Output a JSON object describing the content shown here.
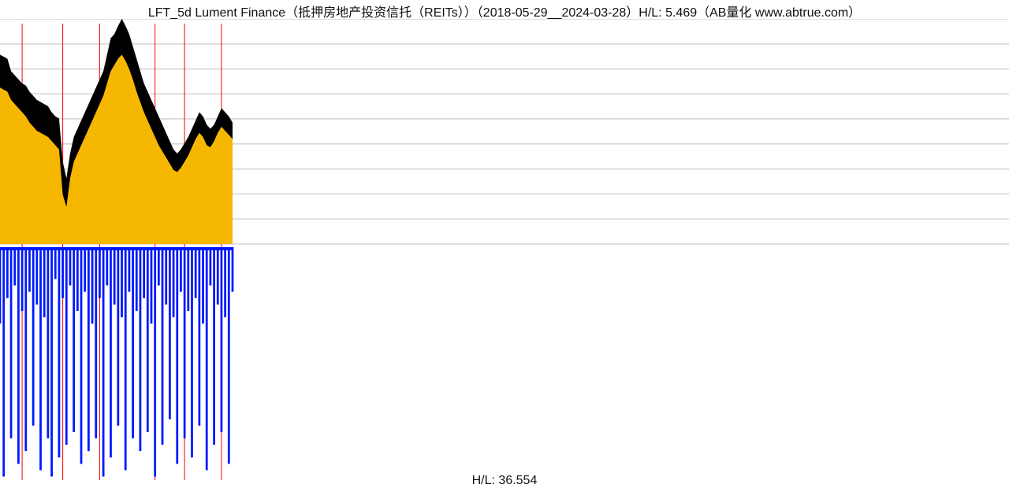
{
  "title": "LFT_5d Lument Finance（抵押房地产投资信托（REITs））（2018-05-29__2024-03-28）H/L: 5.469（AB量化  www.abtrue.com）",
  "bottom_label": "H/L: 36.554",
  "chart_data": {
    "type": "area",
    "title": "LFT_5d Lument Finance（抵押房地产投资信托（REITs））",
    "date_range": [
      "2018-05-29",
      "2024-03-28"
    ],
    "hl_upper": 5.469,
    "hl_lower": 36.554,
    "source": "AB量化  www.abtrue.com",
    "upper_panel": {
      "ylim": [
        0,
        5.469
      ],
      "gridlines_y": [
        0.0,
        0.61,
        1.22,
        1.82,
        2.43,
        3.04,
        3.65,
        4.25,
        4.86,
        5.47
      ],
      "vlines_x_index": [
        6,
        17,
        27,
        42,
        50,
        60
      ],
      "series": [
        {
          "name": "high_band",
          "color": "#000000",
          "values": [
            4.6,
            4.55,
            4.5,
            4.2,
            4.1,
            4.0,
            3.9,
            3.85,
            3.7,
            3.6,
            3.5,
            3.45,
            3.4,
            3.35,
            3.2,
            3.1,
            3.05,
            2.0,
            1.6,
            2.2,
            2.6,
            2.8,
            3.0,
            3.2,
            3.4,
            3.6,
            3.8,
            4.0,
            4.2,
            4.6,
            5.0,
            5.1,
            5.3,
            5.47,
            5.3,
            5.1,
            4.8,
            4.5,
            4.2,
            3.9,
            3.7,
            3.5,
            3.3,
            3.1,
            2.9,
            2.7,
            2.5,
            2.3,
            2.2,
            2.3,
            2.45,
            2.6,
            2.8,
            3.0,
            3.2,
            3.1,
            2.9,
            2.8,
            2.9,
            3.1,
            3.3,
            3.2,
            3.1,
            2.95
          ]
        },
        {
          "name": "low_band",
          "color": "#f6b700",
          "values": [
            3.8,
            3.75,
            3.7,
            3.5,
            3.4,
            3.3,
            3.2,
            3.1,
            2.95,
            2.85,
            2.75,
            2.7,
            2.65,
            2.6,
            2.5,
            2.4,
            2.3,
            1.2,
            0.9,
            1.6,
            2.0,
            2.2,
            2.4,
            2.6,
            2.8,
            3.0,
            3.2,
            3.4,
            3.6,
            3.9,
            4.2,
            4.35,
            4.5,
            4.6,
            4.45,
            4.25,
            4.0,
            3.7,
            3.45,
            3.2,
            3.0,
            2.8,
            2.6,
            2.4,
            2.25,
            2.1,
            1.95,
            1.8,
            1.75,
            1.85,
            2.0,
            2.15,
            2.35,
            2.55,
            2.7,
            2.6,
            2.4,
            2.35,
            2.5,
            2.7,
            2.85,
            2.75,
            2.65,
            2.55
          ]
        }
      ]
    },
    "lower_panel": {
      "ylim": [
        0,
        36.554
      ],
      "series": [
        {
          "name": "volume_like",
          "color": "#0018ff",
          "values": [
            12,
            36,
            8,
            30,
            6,
            34,
            10,
            32,
            7,
            28,
            9,
            35,
            11,
            30,
            36,
            5,
            33,
            8,
            31,
            6,
            29,
            10,
            34,
            7,
            32,
            12,
            30,
            8,
            36,
            6,
            33,
            9,
            28,
            11,
            35,
            7,
            30,
            10,
            32,
            8,
            29,
            12,
            36,
            6,
            31,
            9,
            27,
            11,
            34,
            7,
            30,
            10,
            33,
            8,
            28,
            12,
            35,
            6,
            31,
            9,
            29,
            11,
            34,
            7
          ]
        }
      ]
    }
  }
}
